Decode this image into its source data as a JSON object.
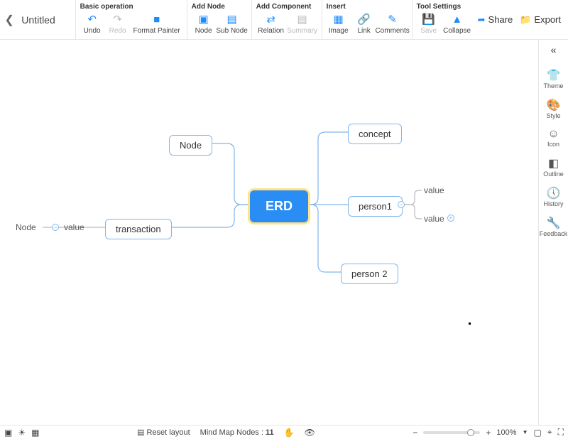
{
  "doc": {
    "title": "Untitled"
  },
  "toolbar": {
    "groups": {
      "basic": {
        "title": "Basic operation",
        "undo": "Undo",
        "redo": "Redo",
        "format_painter": "Format Painter"
      },
      "add_node": {
        "title": "Add Node",
        "node": "Node",
        "sub_node": "Sub Node"
      },
      "add_component": {
        "title": "Add Component",
        "relation": "Relation",
        "summary": "Summary"
      },
      "insert": {
        "title": "Insert",
        "image": "Image",
        "link": "Link",
        "comments": "Comments"
      },
      "tool_settings": {
        "title": "Tool Settings",
        "save": "Save",
        "collapse": "Collapse"
      }
    },
    "right": {
      "share": "Share",
      "export": "Export"
    }
  },
  "side": {
    "theme": "Theme",
    "style": "Style",
    "icon": "Icon",
    "outline": "Outline",
    "history": "History",
    "feedback": "Feedback"
  },
  "mindmap": {
    "root": "ERD",
    "node": "Node",
    "transaction": "transaction",
    "concept": "concept",
    "person1": "person1",
    "person2": "person 2",
    "value": "value",
    "left_node_label": "Node",
    "left_value_label": "value"
  },
  "status": {
    "reset": "Reset layout",
    "nodes_label": "Mind Map Nodes :",
    "nodes_count": "11",
    "zoom": "100%"
  }
}
